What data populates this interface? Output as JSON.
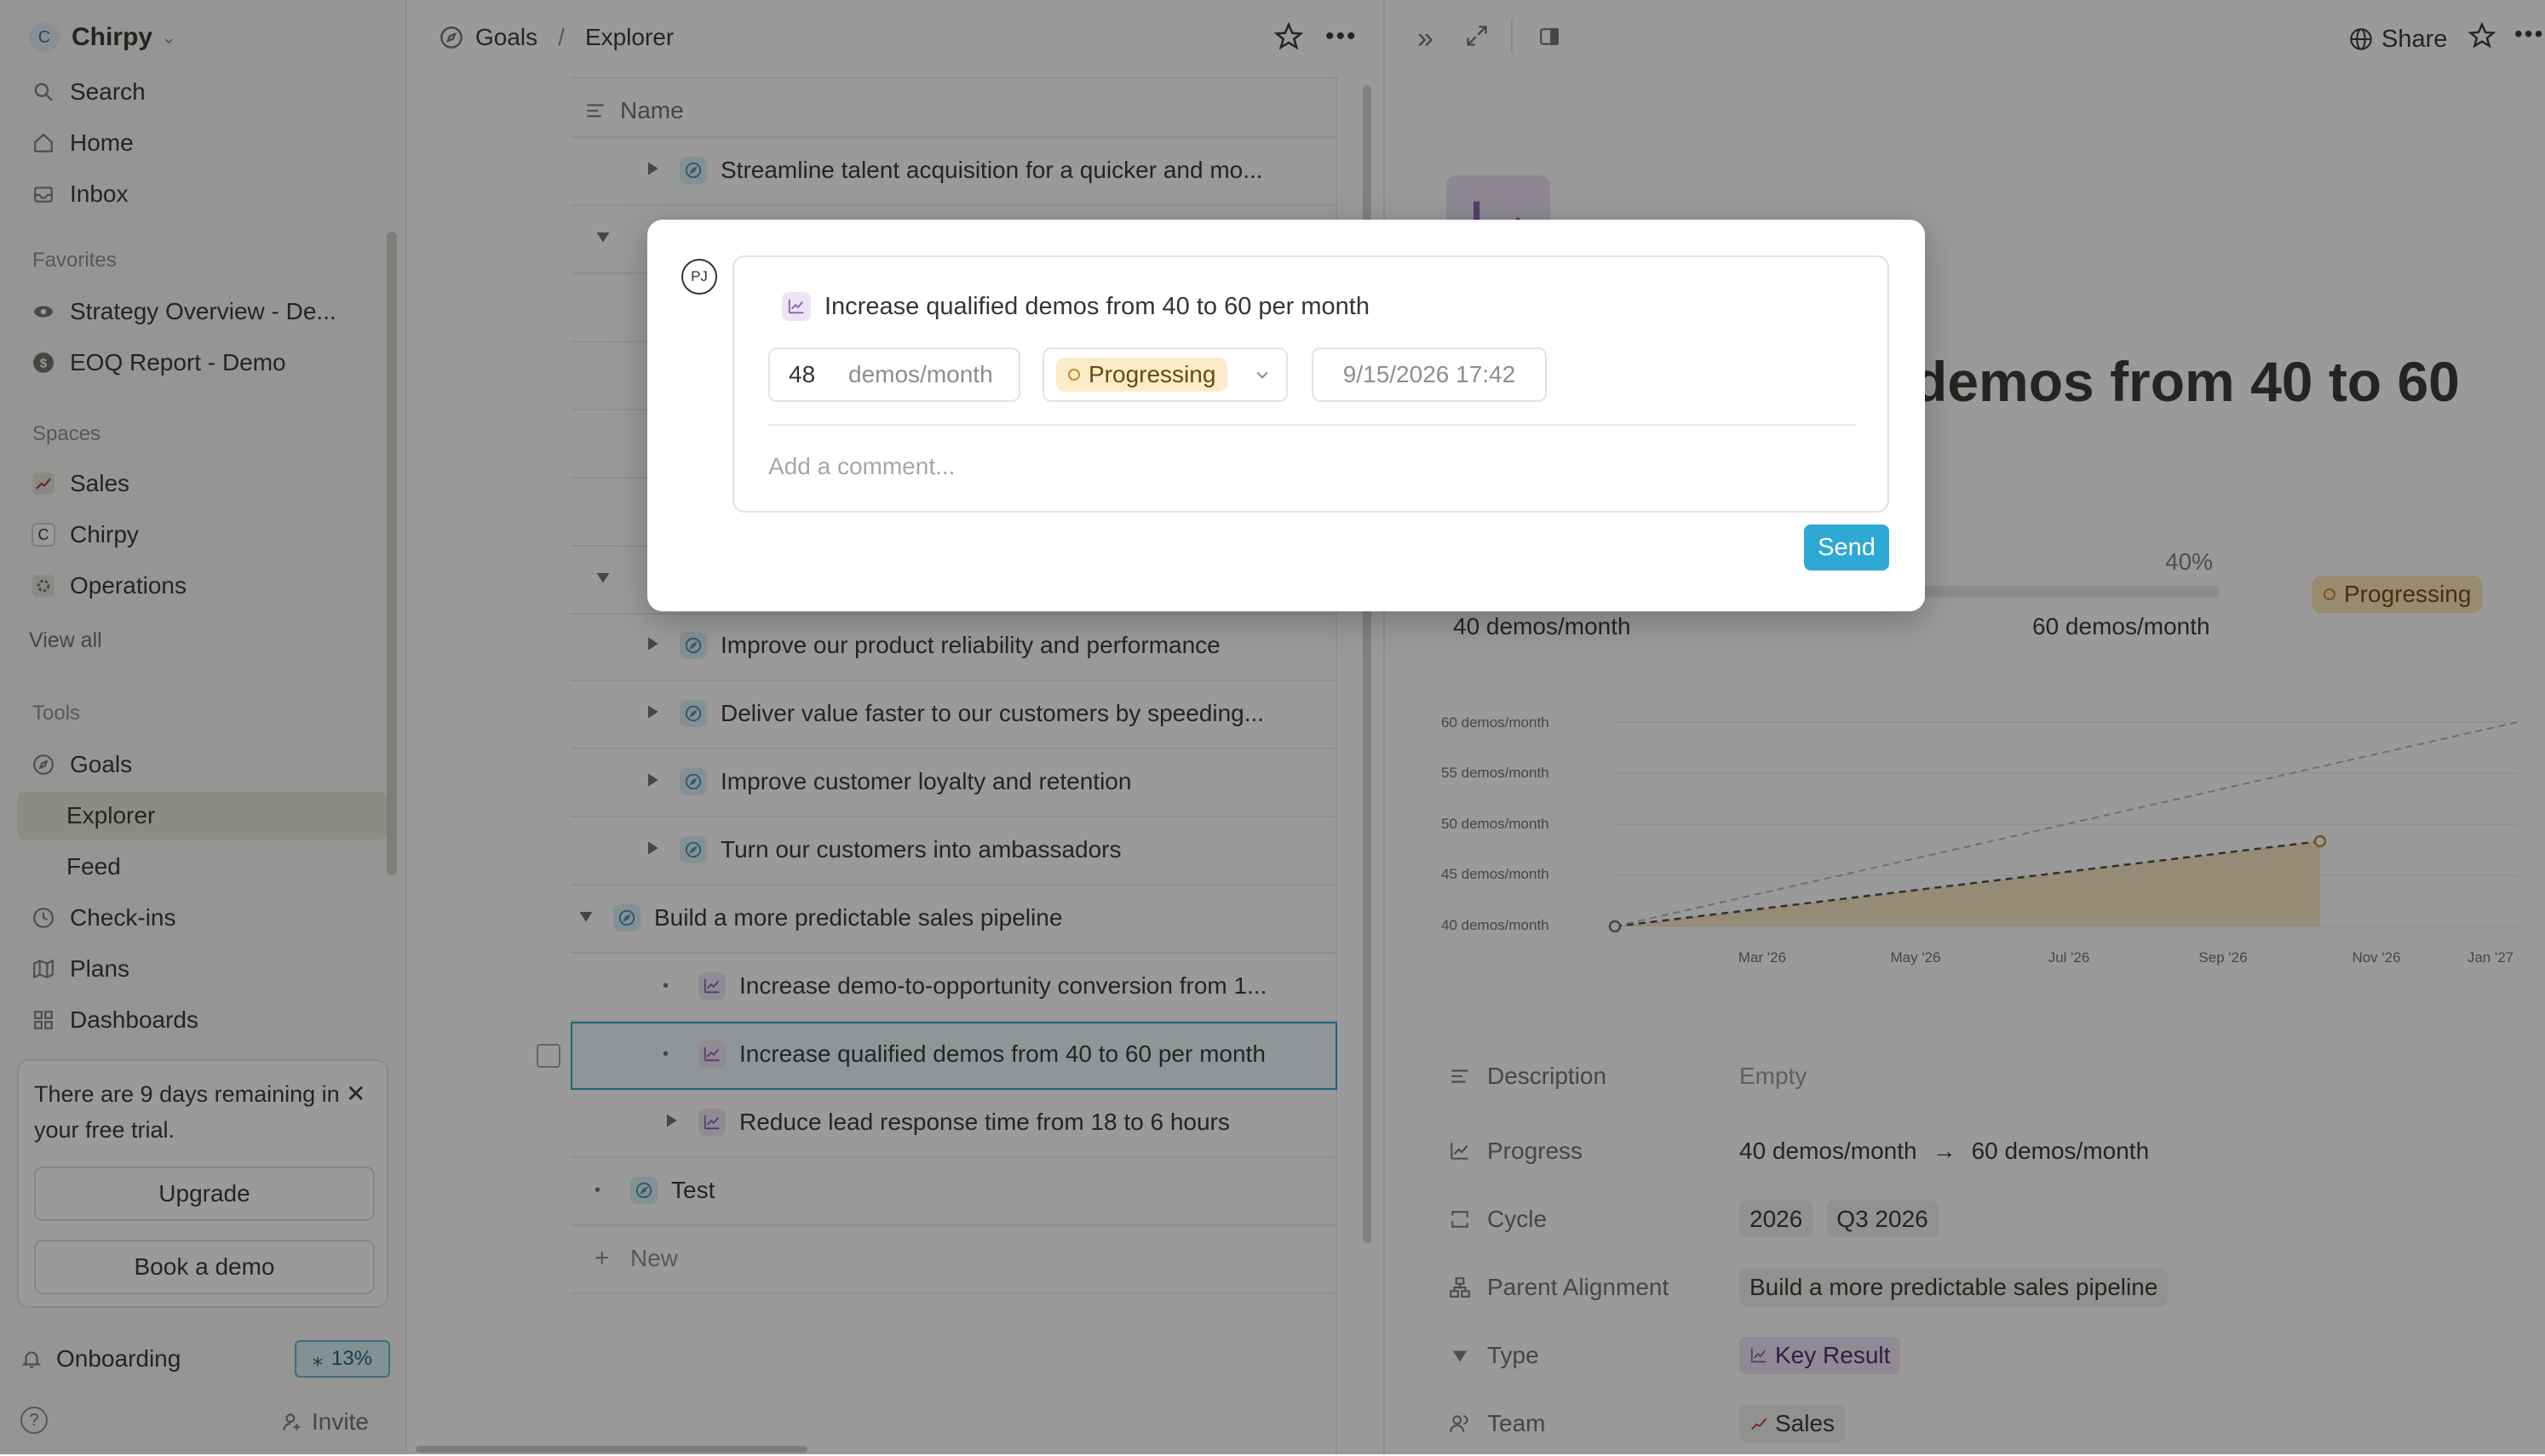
{
  "sidebar": {
    "workspace": "Chirpy",
    "workspace_initial": "C",
    "nav": {
      "search": "Search",
      "home": "Home",
      "inbox": "Inbox"
    },
    "favorites_title": "Favorites",
    "favorites": [
      "Strategy Overview - De...",
      "EOQ Report - Demo"
    ],
    "spaces_title": "Spaces",
    "spaces": [
      "Sales",
      "Chirpy",
      "Operations"
    ],
    "spaces_initial_chirpy": "C",
    "view_all": "View all",
    "tools_title": "Tools",
    "tools": {
      "goals": "Goals",
      "explorer": "Explorer",
      "feed": "Feed",
      "checkins": "Check-ins",
      "plans": "Plans",
      "dashboards": "Dashboards"
    },
    "trial": {
      "text": "There are 9 days remaining in your free trial.",
      "upgrade": "Upgrade",
      "book_demo": "Book a demo"
    },
    "onboarding": "Onboarding",
    "onboarding_pct": "13%",
    "help": "?",
    "invite": "Invite"
  },
  "main": {
    "breadcrumb": {
      "root": "Goals",
      "sep": "/",
      "current": "Explorer"
    },
    "column_name": "Name",
    "rows": {
      "r1": "Streamline talent acquisition for a quicker and mo...",
      "r2": "Improve our product reliability and performance",
      "r3": "Deliver value faster to our customers by speeding...",
      "r4": "Improve customer loyalty and retention",
      "r5": "Turn our customers into ambassadors",
      "r6": "Build a more predictable sales pipeline",
      "r7": "Increase demo-to-opportunity conversion from 1...",
      "r8": "Increase qualified demos from 40 to 60 per month",
      "r9": "Reduce lead response time from 18 to 6 hours",
      "r10": "Test"
    },
    "new_label": "New",
    "new_plus": "+"
  },
  "panel": {
    "share": "Share",
    "title_fragment": "demos from 40 to 60",
    "progress_pct": "40%",
    "progress_fraction": 0.4,
    "start_label": "40 demos/month",
    "target_label": "60 demos/month",
    "status": "Progressing",
    "chart": {
      "y_ticks": [
        "60 demos/month",
        "55 demos/month",
        "50 demos/month",
        "45 demos/month",
        "40 demos/month"
      ],
      "x_ticks": [
        "Mar '26",
        "May '26",
        "Jul '26",
        "Sep '26",
        "Nov '26",
        "Jan '27"
      ]
    },
    "props": {
      "description": {
        "label": "Description",
        "value": "Empty"
      },
      "progress": {
        "label": "Progress",
        "from": "40 demos/month",
        "arrow": "→",
        "to": "60 demos/month"
      },
      "cycle": {
        "label": "Cycle",
        "values": [
          "2026",
          "Q3 2026"
        ]
      },
      "parent": {
        "label": "Parent Alignment",
        "value": "Build a more predictable sales pipeline"
      },
      "type": {
        "label": "Type",
        "value": "Key Result"
      },
      "team": {
        "label": "Team",
        "value": "Sales"
      }
    }
  },
  "modal": {
    "avatar": "PJ",
    "title": "Increase qualified demos from 40 to 60 per month",
    "value": "48",
    "unit": "demos/month",
    "status": "Progressing",
    "datetime": "9/15/2026 17:42",
    "comment_placeholder": "Add a comment...",
    "send": "Send"
  }
}
